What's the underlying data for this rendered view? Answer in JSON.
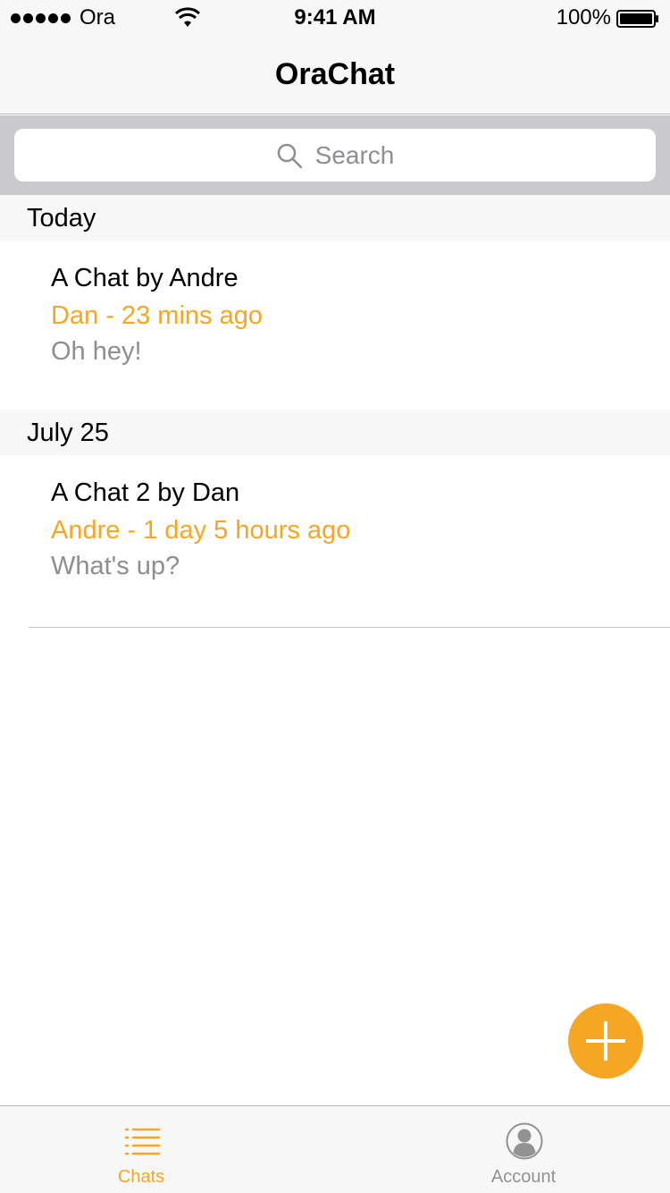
{
  "status_bar": {
    "carrier": "Ora",
    "time": "9:41 AM",
    "battery_percent": "100%"
  },
  "nav": {
    "title": "OraChat"
  },
  "search": {
    "placeholder": "Search"
  },
  "sections": [
    {
      "header": "Today",
      "chats": [
        {
          "title": "A Chat by Andre",
          "meta": "Dan - 23 mins ago",
          "preview": "Oh hey!"
        }
      ]
    },
    {
      "header": "July 25",
      "chats": [
        {
          "title": "A Chat 2 by Dan",
          "meta": "Andre - 1 day 5 hours ago",
          "preview": "What's up?"
        }
      ]
    }
  ],
  "fab": {
    "icon": "plus-icon"
  },
  "tab_bar": {
    "tabs": [
      {
        "label": "Chats",
        "icon": "list-icon",
        "selected": true
      },
      {
        "label": "Account",
        "icon": "person-icon",
        "selected": false
      }
    ]
  },
  "colors": {
    "accent": "#f5a623",
    "secondary_text": "#8e8e93",
    "bar_background": "#f7f7f7"
  }
}
